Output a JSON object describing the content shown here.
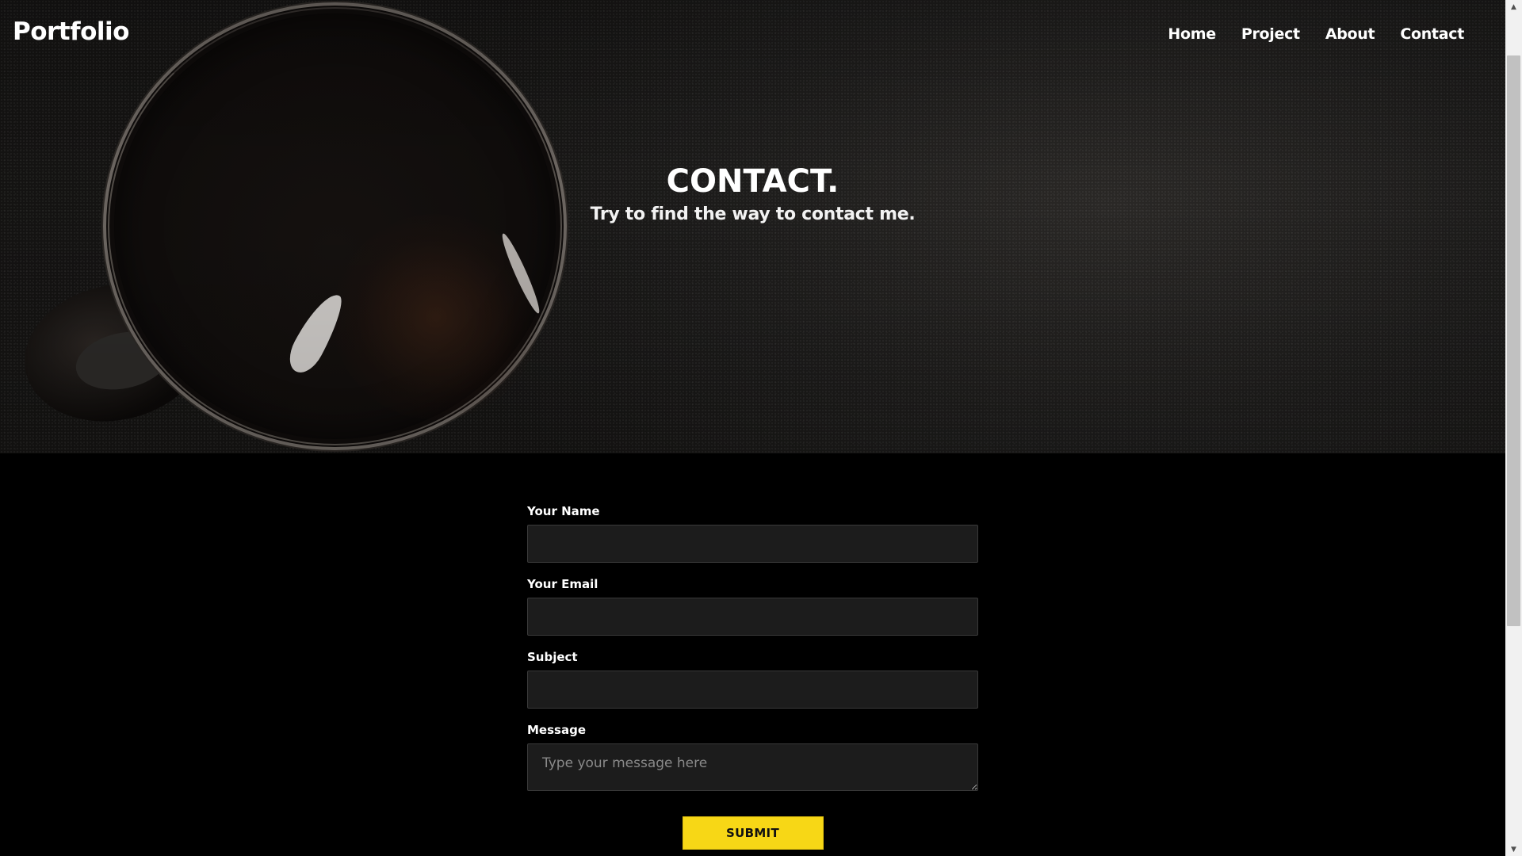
{
  "header": {
    "logo": "Portfolio",
    "nav": [
      {
        "label": "Home"
      },
      {
        "label": "Project"
      },
      {
        "label": "About"
      },
      {
        "label": "Contact"
      }
    ]
  },
  "hero": {
    "title": "CONTACT.",
    "subtitle": "Try to find the way to contact me."
  },
  "form": {
    "name_label": "Your Name",
    "name_value": "",
    "email_label": "Your Email",
    "email_value": "",
    "subject_label": "Subject",
    "subject_value": "",
    "message_label": "Message",
    "message_placeholder": "Type your message here",
    "submit_label": "SUBMIT"
  },
  "colors": {
    "accent": "#f7d716",
    "page_background": "#000000",
    "input_background": "#1c1c1c"
  },
  "icons": {
    "scroll_up": "triangle-up-icon",
    "scroll_down": "triangle-down-icon",
    "resize_handle": "resize-grip-icon"
  }
}
